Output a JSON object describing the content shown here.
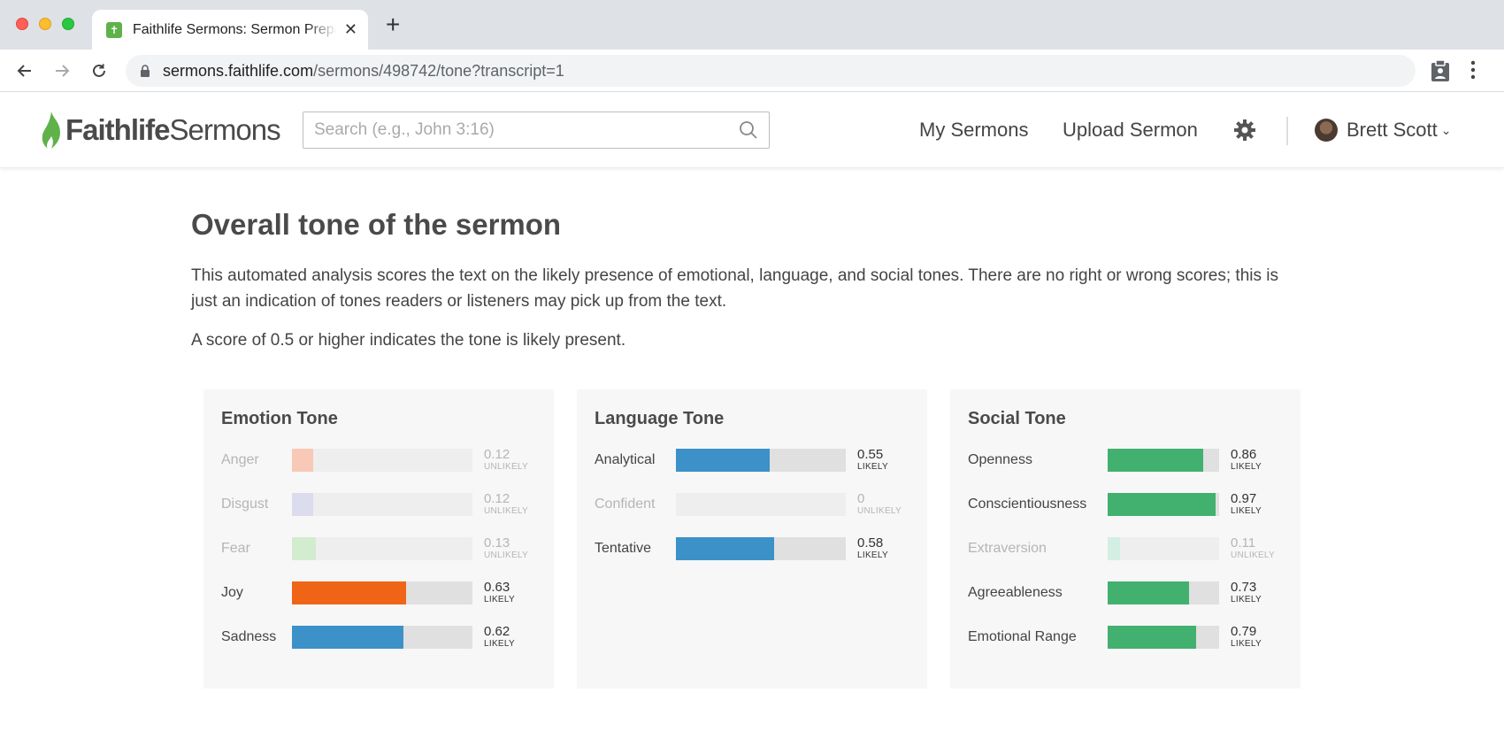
{
  "browser": {
    "tab_title": "Faithlife Sermons: Sermon Preparation",
    "url_host": "sermons.faithlife.com",
    "url_path": "/sermons/498742/tone?transcript=1"
  },
  "header": {
    "logo_part1": "Faithlife",
    "logo_part2": "Sermons",
    "search_placeholder": "Search (e.g., John 3:16)",
    "nav_my_sermons": "My Sermons",
    "nav_upload": "Upload Sermon",
    "user_name": "Brett Scott",
    "brand_color": "#5fb14a"
  },
  "main": {
    "title": "Overall tone of the sermon",
    "description": "This automated analysis scores the text on the likely presence of emotional, language, and social tones. There are no right or wrong scores; this is just an indication of tones readers or listeners may pick up from the text.",
    "threshold_note": "A score of 0.5 or higher indicates the tone is likely present."
  },
  "cards": [
    {
      "title": "Emotion Tone",
      "label_width": 80,
      "bar_width": 204,
      "items": [
        {
          "label": "Anger",
          "score": "0.12",
          "value": 0.12,
          "verdict": "UNLIKELY",
          "color": "#f8c9b6"
        },
        {
          "label": "Disgust",
          "score": "0.12",
          "value": 0.12,
          "verdict": "UNLIKELY",
          "color": "#dcdcef"
        },
        {
          "label": "Fear",
          "score": "0.13",
          "value": 0.13,
          "verdict": "UNLIKELY",
          "color": "#d3ecd0"
        },
        {
          "label": "Joy",
          "score": "0.63",
          "value": 0.63,
          "verdict": "LIKELY",
          "color": "#f06418"
        },
        {
          "label": "Sadness",
          "score": "0.62",
          "value": 0.62,
          "verdict": "LIKELY",
          "color": "#3c91c9"
        }
      ]
    },
    {
      "title": "Language Tone",
      "label_width": 92,
      "bar_width": 192,
      "items": [
        {
          "label": "Analytical",
          "score": "0.55",
          "value": 0.55,
          "verdict": "LIKELY",
          "color": "#3c91c9"
        },
        {
          "label": "Confident",
          "score": "0",
          "value": 0,
          "verdict": "UNLIKELY",
          "color": "#cfe3f1"
        },
        {
          "label": "Tentative",
          "score": "0.58",
          "value": 0.58,
          "verdict": "LIKELY",
          "color": "#3c91c9"
        }
      ]
    },
    {
      "title": "Social Tone",
      "label_width": 158,
      "bar_width": 126,
      "items": [
        {
          "label": "Openness",
          "score": "0.86",
          "value": 0.86,
          "verdict": "LIKELY",
          "color": "#42b06f"
        },
        {
          "label": "Conscientiousness",
          "score": "0.97",
          "value": 0.97,
          "verdict": "LIKELY",
          "color": "#42b06f"
        },
        {
          "label": "Extraversion",
          "score": "0.11",
          "value": 0.11,
          "verdict": "UNLIKELY",
          "color": "#d3efe3"
        },
        {
          "label": "Agreeableness",
          "score": "0.73",
          "value": 0.73,
          "verdict": "LIKELY",
          "color": "#42b06f"
        },
        {
          "label": "Emotional Range",
          "score": "0.79",
          "value": 0.79,
          "verdict": "LIKELY",
          "color": "#42b06f"
        }
      ]
    }
  ]
}
